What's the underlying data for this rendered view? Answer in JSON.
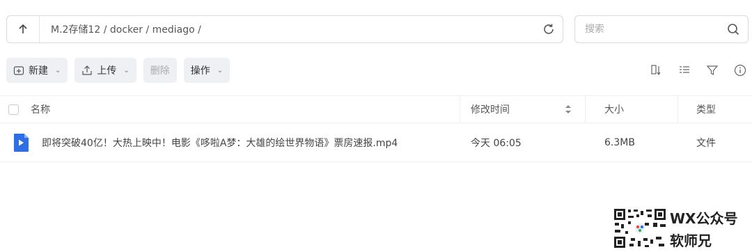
{
  "pathbar": {
    "path": "M.2存储12 / docker / mediago /"
  },
  "search": {
    "placeholder": "搜索"
  },
  "toolbar": {
    "new_label": "新建",
    "upload_label": "上传",
    "delete_label": "删除",
    "actions_label": "操作"
  },
  "table": {
    "headers": {
      "name": "名称",
      "modified": "修改时间",
      "size": "大小",
      "type": "类型"
    },
    "rows": [
      {
        "name": "即将突破40亿！大热上映中！电影《哆啦A梦：大雄的绘世界物语》票房速报.mp4",
        "modified": "今天 06:05",
        "size": "6.3MB",
        "type": "文件"
      }
    ]
  },
  "watermark": {
    "line1": "WX公众号",
    "line2": "软师兄"
  },
  "colors": {
    "file_icon": "#2f6fe4",
    "border": "#d9d9d9",
    "button_bg": "#eef0f3"
  }
}
